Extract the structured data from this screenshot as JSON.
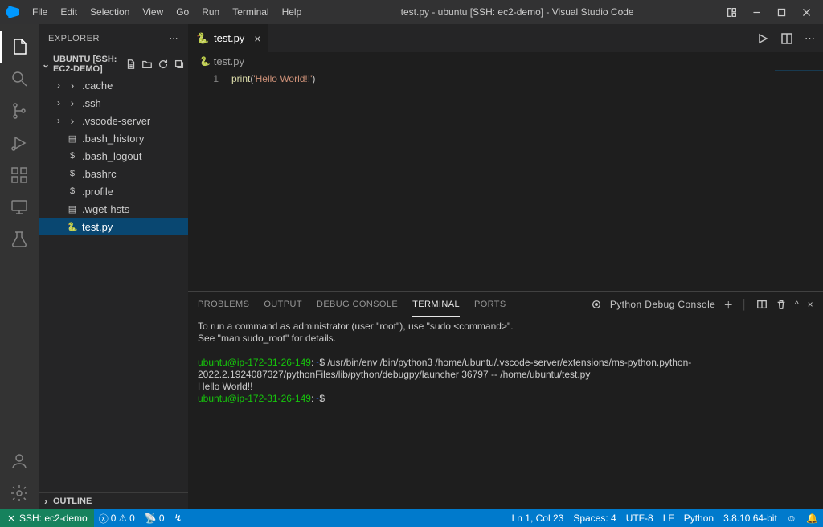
{
  "titlebar": {
    "menu": [
      "File",
      "Edit",
      "Selection",
      "View",
      "Go",
      "Run",
      "Terminal",
      "Help"
    ],
    "title": "test.py - ubuntu [SSH: ec2-demo] - Visual Studio Code"
  },
  "sidebar": {
    "title": "EXPLORER",
    "workspace": "UBUNTU [SSH: EC2-DEMO]",
    "tree": [
      {
        "indent": 1,
        "chev": "right",
        "icon": "folder",
        "label": ".cache"
      },
      {
        "indent": 1,
        "chev": "right",
        "icon": "folder",
        "label": ".ssh"
      },
      {
        "indent": 1,
        "chev": "right",
        "icon": "folder",
        "label": ".vscode-server"
      },
      {
        "indent": 1,
        "chev": "",
        "icon": "file",
        "label": ".bash_history"
      },
      {
        "indent": 1,
        "chev": "",
        "icon": "dollar",
        "label": ".bash_logout"
      },
      {
        "indent": 1,
        "chev": "",
        "icon": "dollar",
        "label": ".bashrc"
      },
      {
        "indent": 1,
        "chev": "",
        "icon": "dollar",
        "label": ".profile"
      },
      {
        "indent": 1,
        "chev": "",
        "icon": "file",
        "label": ".wget-hsts"
      },
      {
        "indent": 1,
        "chev": "",
        "icon": "py",
        "label": "test.py",
        "selected": true
      }
    ],
    "outline": "OUTLINE"
  },
  "editor": {
    "tab": {
      "label": "test.py",
      "icon": "🐍"
    },
    "breadcrumb": {
      "icon": "🐍",
      "label": "test.py"
    },
    "line_number": "1",
    "code": {
      "fn": "print",
      "paren_open": "(",
      "str": "'Hello World!!'",
      "paren_close": ")"
    }
  },
  "panel": {
    "tabs": [
      "PROBLEMS",
      "OUTPUT",
      "DEBUG CONSOLE",
      "TERMINAL",
      "PORTS"
    ],
    "active_tab": "TERMINAL",
    "dropdown": "Python Debug Console",
    "terminal": {
      "line1": "To run a command as administrator (user \"root\"), use \"sudo <command>\".",
      "line2": "See \"man sudo_root\" for details.",
      "prompt1": "ubuntu@ip-172-31-26-149",
      "path_sep": ":",
      "tilde": "~",
      "dollar": "$",
      "cmd1": " /usr/bin/env /bin/python3 /home/ubuntu/.vscode-server/extensions/ms-python.python-2022.2.1924087327/pythonFiles/lib/python/debugpy/launcher 36797 -- /home/ubuntu/test.py",
      "output": "Hello World!!",
      "prompt2": "ubuntu@ip-172-31-26-149"
    }
  },
  "statusbar": {
    "remote": "SSH: ec2-demo",
    "problems": {
      "errors": "0",
      "warnings": "0"
    },
    "ports": "0",
    "cursor": "Ln 1, Col 23",
    "spaces": "Spaces: 4",
    "encoding": "UTF-8",
    "eol": "LF",
    "lang": "Python",
    "interpreter": "3.8.10 64-bit"
  }
}
